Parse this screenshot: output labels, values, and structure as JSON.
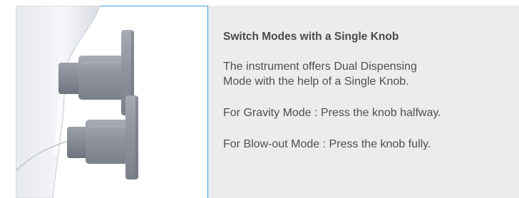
{
  "feature": {
    "title": "Switch Modes with a Single Knob",
    "description": "The instrument offers Dual Dispensing Mode with the help of a Single Knob.",
    "modes": [
      {
        "text": "For Gravity Mode : Press the knob halfway."
      },
      {
        "text": "For Blow-out Mode : Press the knob fully."
      }
    ]
  },
  "colors": {
    "panel_background": "#ececec",
    "image_frame_accent": "#3d9fd8",
    "knob_color": "#8f949e",
    "text_color": "#4f4f4f"
  },
  "image": {
    "subject": "instrument-body-with-two-knobs"
  }
}
